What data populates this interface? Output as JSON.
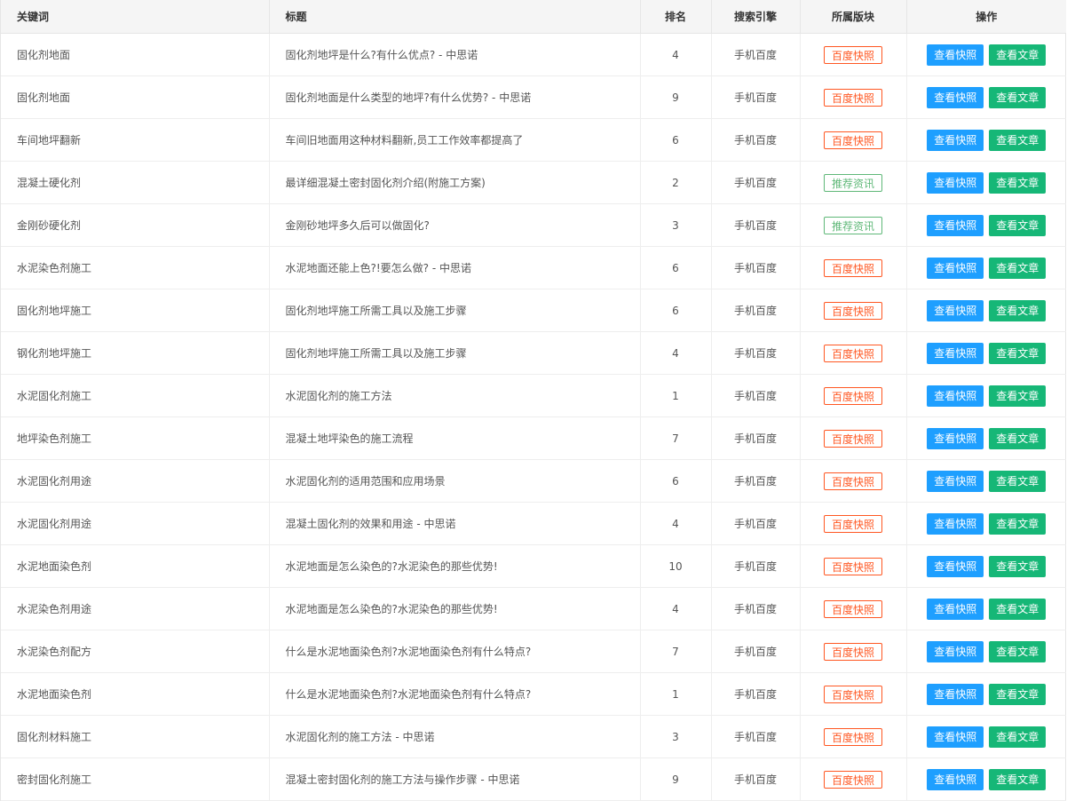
{
  "table": {
    "headers": {
      "keyword": "关键词",
      "title": "标题",
      "rank": "排名",
      "engine": "搜索引擎",
      "section": "所属版块",
      "actions": "操作"
    },
    "tag_colors": {
      "red": "#ff5722",
      "green": "#5fb878"
    },
    "button_colors": {
      "snapshot": "#1e9fff",
      "article": "#16b777"
    },
    "rows": [
      {
        "keyword": "固化剂地面",
        "title": "固化剂地坪是什么?有什么优点? - 中思诺",
        "rank": "4",
        "engine": "手机百度",
        "section": "百度快照",
        "section_color": "red",
        "snapshot_btn": "查看快照",
        "article_btn": "查看文章"
      },
      {
        "keyword": "固化剂地面",
        "title": "固化剂地面是什么类型的地坪?有什么优势? - 中思诺",
        "rank": "9",
        "engine": "手机百度",
        "section": "百度快照",
        "section_color": "red",
        "snapshot_btn": "查看快照",
        "article_btn": "查看文章"
      },
      {
        "keyword": "车间地坪翻新",
        "title": "车间旧地面用这种材料翻新,员工工作效率都提高了",
        "rank": "6",
        "engine": "手机百度",
        "section": "百度快照",
        "section_color": "red",
        "snapshot_btn": "查看快照",
        "article_btn": "查看文章"
      },
      {
        "keyword": "混凝土硬化剂",
        "title": "最详细混凝土密封固化剂介绍(附施工方案)",
        "rank": "2",
        "engine": "手机百度",
        "section": "推荐资讯",
        "section_color": "green",
        "snapshot_btn": "查看快照",
        "article_btn": "查看文章"
      },
      {
        "keyword": "金刚砂硬化剂",
        "title": "金刚砂地坪多久后可以做固化?",
        "rank": "3",
        "engine": "手机百度",
        "section": "推荐资讯",
        "section_color": "green",
        "snapshot_btn": "查看快照",
        "article_btn": "查看文章"
      },
      {
        "keyword": "水泥染色剂施工",
        "title": "水泥地面还能上色?!要怎么做? - 中思诺",
        "rank": "6",
        "engine": "手机百度",
        "section": "百度快照",
        "section_color": "red",
        "snapshot_btn": "查看快照",
        "article_btn": "查看文章"
      },
      {
        "keyword": "固化剂地坪施工",
        "title": "固化剂地坪施工所需工具以及施工步骤",
        "rank": "6",
        "engine": "手机百度",
        "section": "百度快照",
        "section_color": "red",
        "snapshot_btn": "查看快照",
        "article_btn": "查看文章"
      },
      {
        "keyword": "钢化剂地坪施工",
        "title": "固化剂地坪施工所需工具以及施工步骤",
        "rank": "4",
        "engine": "手机百度",
        "section": "百度快照",
        "section_color": "red",
        "snapshot_btn": "查看快照",
        "article_btn": "查看文章"
      },
      {
        "keyword": "水泥固化剂施工",
        "title": "水泥固化剂的施工方法",
        "rank": "1",
        "engine": "手机百度",
        "section": "百度快照",
        "section_color": "red",
        "snapshot_btn": "查看快照",
        "article_btn": "查看文章"
      },
      {
        "keyword": "地坪染色剂施工",
        "title": "混凝土地坪染色的施工流程",
        "rank": "7",
        "engine": "手机百度",
        "section": "百度快照",
        "section_color": "red",
        "snapshot_btn": "查看快照",
        "article_btn": "查看文章"
      },
      {
        "keyword": "水泥固化剂用途",
        "title": "水泥固化剂的适用范围和应用场景",
        "rank": "6",
        "engine": "手机百度",
        "section": "百度快照",
        "section_color": "red",
        "snapshot_btn": "查看快照",
        "article_btn": "查看文章"
      },
      {
        "keyword": "水泥固化剂用途",
        "title": "混凝土固化剂的效果和用途 - 中思诺",
        "rank": "4",
        "engine": "手机百度",
        "section": "百度快照",
        "section_color": "red",
        "snapshot_btn": "查看快照",
        "article_btn": "查看文章"
      },
      {
        "keyword": "水泥地面染色剂",
        "title": "水泥地面是怎么染色的?水泥染色的那些优势!",
        "rank": "10",
        "engine": "手机百度",
        "section": "百度快照",
        "section_color": "red",
        "snapshot_btn": "查看快照",
        "article_btn": "查看文章"
      },
      {
        "keyword": "水泥染色剂用途",
        "title": "水泥地面是怎么染色的?水泥染色的那些优势!",
        "rank": "4",
        "engine": "手机百度",
        "section": "百度快照",
        "section_color": "red",
        "snapshot_btn": "查看快照",
        "article_btn": "查看文章"
      },
      {
        "keyword": "水泥染色剂配方",
        "title": "什么是水泥地面染色剂?水泥地面染色剂有什么特点?",
        "rank": "7",
        "engine": "手机百度",
        "section": "百度快照",
        "section_color": "red",
        "snapshot_btn": "查看快照",
        "article_btn": "查看文章"
      },
      {
        "keyword": "水泥地面染色剂",
        "title": "什么是水泥地面染色剂?水泥地面染色剂有什么特点?",
        "rank": "1",
        "engine": "手机百度",
        "section": "百度快照",
        "section_color": "red",
        "snapshot_btn": "查看快照",
        "article_btn": "查看文章"
      },
      {
        "keyword": "固化剂材料施工",
        "title": "水泥固化剂的施工方法 - 中思诺",
        "rank": "3",
        "engine": "手机百度",
        "section": "百度快照",
        "section_color": "red",
        "snapshot_btn": "查看快照",
        "article_btn": "查看文章"
      },
      {
        "keyword": "密封固化剂施工",
        "title": "混凝土密封固化剂的施工方法与操作步骤 - 中思诺",
        "rank": "9",
        "engine": "手机百度",
        "section": "百度快照",
        "section_color": "red",
        "snapshot_btn": "查看快照",
        "article_btn": "查看文章"
      }
    ]
  }
}
